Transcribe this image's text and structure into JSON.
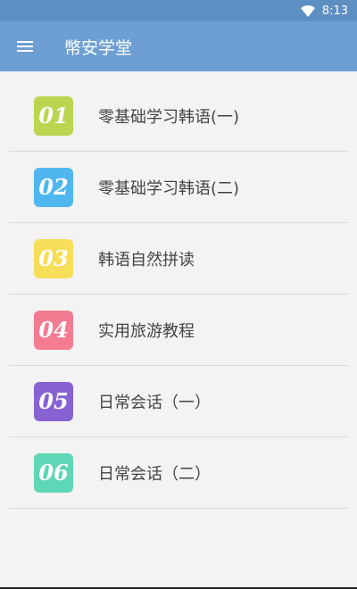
{
  "status_bar": {
    "time": "8:13"
  },
  "app_bar": {
    "title": "幣安学堂"
  },
  "colors": {
    "status": "#5e8fc3",
    "appbar": "#6e9fd2"
  },
  "lessons": [
    {
      "number": "01",
      "label": "零基础学习韩语(一)",
      "color": "#bad54f"
    },
    {
      "number": "02",
      "label": "零基础学习韩语(二)",
      "color": "#4fb6ef"
    },
    {
      "number": "03",
      "label": "韩语自然拼读",
      "color": "#f7de58"
    },
    {
      "number": "04",
      "label": "实用旅游教程",
      "color": "#f47c92"
    },
    {
      "number": "05",
      "label": "日常会话（一）",
      "color": "#8762d3"
    },
    {
      "number": "06",
      "label": "日常会话（二）",
      "color": "#5fd6b5"
    }
  ]
}
